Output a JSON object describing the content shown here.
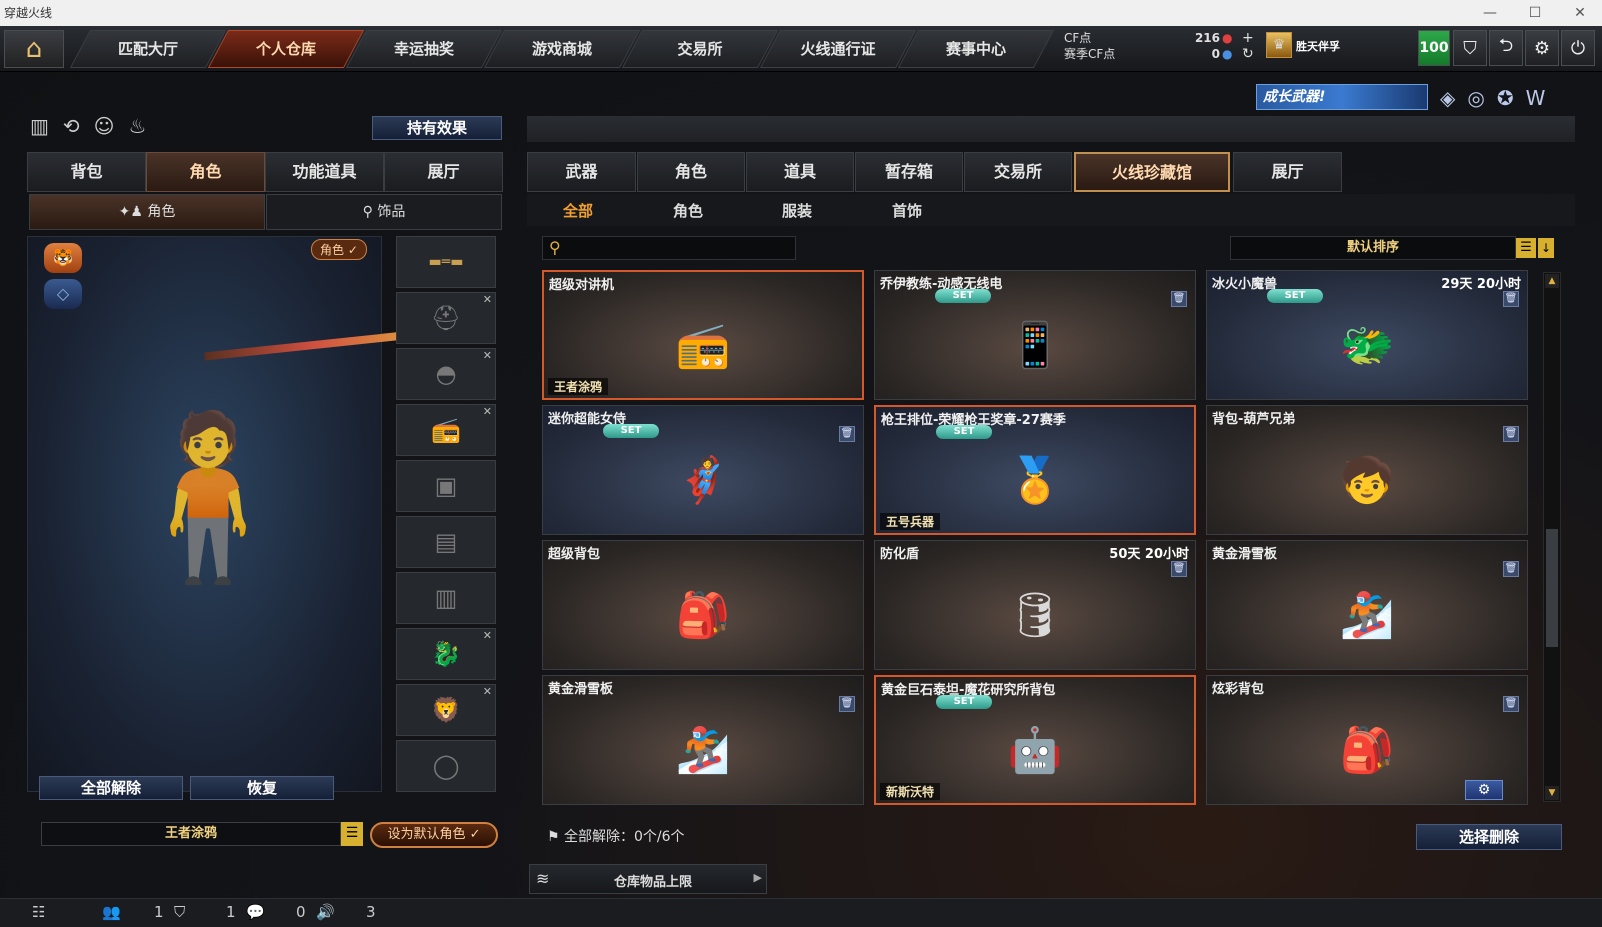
{
  "window": {
    "title": "穿越火线",
    "minimize": "—",
    "maximize": "☐",
    "close": "✕"
  },
  "nav": {
    "home_icon": "home-icon",
    "tabs": [
      "匹配大厅",
      "个人仓库",
      "幸运抽奖",
      "游戏商城",
      "交易所",
      "火线通行证",
      "赛事中心"
    ],
    "active_tab": "个人仓库",
    "cf_label": "CF点",
    "cf_value": "216",
    "season_cf_label": "赛季CF点",
    "season_cf_value": "0",
    "plus": "+",
    "refresh": "↻",
    "player_name": "胜天伴孚",
    "level_badge": "100",
    "icons": [
      "shield-icon",
      "exit-icon",
      "gear-icon",
      "power-icon"
    ]
  },
  "promo": {
    "banner_text": "成长武器!"
  },
  "left": {
    "effect_button": "持有效果",
    "tabs": [
      "背包",
      "角色",
      "功能道具",
      "展厅"
    ],
    "active_tab": "角色",
    "subtabs": [
      "角色",
      "饰品"
    ],
    "role_badge": "角色 ✓",
    "unequip_all": "全部解除",
    "restore": "恢复",
    "character_name": "王者涂鸦",
    "set_default": "设为默认角色 ✓"
  },
  "right": {
    "tabs": [
      "武器",
      "角色",
      "道具",
      "暂存箱",
      "交易所",
      "火线珍藏馆",
      "展厅"
    ],
    "active_tab": "火线珍藏馆",
    "subtabs": [
      "全部",
      "角色",
      "服装",
      "首饰"
    ],
    "active_subtab": "全部",
    "search_placeholder": "",
    "sort_label": "默认排序",
    "items": [
      {
        "name": "超级对讲机",
        "time": "",
        "set": false,
        "trash": false,
        "tag": "王者涂鸦",
        "art": "📻",
        "style": "hl"
      },
      {
        "name": "乔伊教练-动感无线电",
        "time": "",
        "set": true,
        "trash": true,
        "tag": "",
        "art": "📱",
        "style": ""
      },
      {
        "name": "冰火小魔兽",
        "time": "29天 20小时",
        "set": true,
        "trash": true,
        "tag": "",
        "art": "🐲",
        "style": "blue"
      },
      {
        "name": "迷你超能女侍",
        "time": "",
        "set": true,
        "trash": true,
        "tag": "",
        "art": "🦸",
        "style": "blue"
      },
      {
        "name": "枪王排位-荣耀枪王奖章-27赛季",
        "time": "",
        "set": true,
        "trash": false,
        "tag": "五号兵器",
        "art": "🏅",
        "style": "blue hl"
      },
      {
        "name": "背包-葫芦兄弟",
        "time": "",
        "set": false,
        "trash": true,
        "tag": "",
        "art": "🧒",
        "style": ""
      },
      {
        "name": "超级背包",
        "time": "",
        "set": false,
        "trash": false,
        "tag": "",
        "art": "🎒",
        "style": ""
      },
      {
        "name": "防化盾",
        "time": "50天 20小时",
        "set": false,
        "trash": true,
        "tag": "",
        "art": "🛢",
        "style": ""
      },
      {
        "name": "黄金滑雪板",
        "time": "",
        "set": false,
        "trash": true,
        "tag": "",
        "art": "🏂",
        "style": ""
      },
      {
        "name": "黄金滑雪板",
        "time": "",
        "set": false,
        "trash": true,
        "tag": "",
        "art": "🏂",
        "style": ""
      },
      {
        "name": "黄金巨石泰坦-魔花研究所背包",
        "time": "",
        "set": true,
        "trash": false,
        "tag": "新斯沃特",
        "art": "🤖",
        "style": "hl"
      },
      {
        "name": "炫彩背包",
        "time": "",
        "set": false,
        "trash": true,
        "tag": "",
        "art": "🎒",
        "style": "",
        "gear": true
      }
    ],
    "set_label": "SET",
    "unequip_summary": "全部解除：0个/6个",
    "select_delete": "选择删除",
    "storage_limit": "仓库物品上限"
  },
  "status": {
    "counts": [
      "1",
      "1",
      "0",
      "3"
    ]
  }
}
